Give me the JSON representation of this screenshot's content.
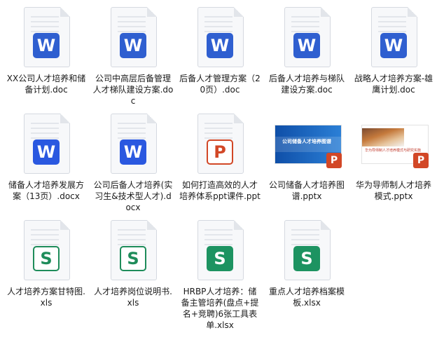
{
  "files": [
    {
      "name": "XX公司人才培养和储备计划.doc",
      "type": "doc",
      "icon": "word-icon",
      "letter": "W"
    },
    {
      "name": "公司中高层后备管理人才梯队建设方案.doc",
      "type": "doc",
      "icon": "word-icon",
      "letter": "W"
    },
    {
      "name": "后备人才管理方案（20页）.doc",
      "type": "doc",
      "icon": "word-icon",
      "letter": "W"
    },
    {
      "name": "后备人才培养与梯队建设方案.doc",
      "type": "doc",
      "icon": "word-icon",
      "letter": "W"
    },
    {
      "name": "战略人才培养方案-雄鹰计划.doc",
      "type": "doc",
      "icon": "word-icon",
      "letter": "W"
    },
    {
      "name": "储备人才培养发展方案（13页）.docx",
      "type": "docx",
      "icon": "word-icon",
      "letter": "W"
    },
    {
      "name": "公司后备人才培养(实习生&技术型人才).docx",
      "type": "docx",
      "icon": "word-icon",
      "letter": "W"
    },
    {
      "name": "如何打造高效的人才培养体系ppt课件.ppt",
      "type": "ppt",
      "icon": "powerpoint-icon",
      "letter": "P"
    },
    {
      "name": "公司储备人才培养图谱.pptx",
      "type": "pptx-blue",
      "icon": "powerpoint-icon",
      "letter": "P",
      "thumb_text": "公司储备人才培养图谱"
    },
    {
      "name": "华为导师制人才培养模式.pptx",
      "type": "pptx-photo",
      "icon": "powerpoint-icon",
      "letter": "P",
      "thumb_text": "华为导师制人才培养模式与研究实施"
    },
    {
      "name": "人才培养方案甘特图.xls",
      "type": "xls",
      "icon": "excel-icon",
      "letter": "S"
    },
    {
      "name": "人才培养岗位说明书.xls",
      "type": "xls",
      "icon": "excel-icon",
      "letter": "S"
    },
    {
      "name": "HRBP人才培养：储备主管培养(盘点+提名+竞聘)6张工具表单.xlsx",
      "type": "xlsx",
      "icon": "excel-icon",
      "letter": "S"
    },
    {
      "name": "重点人才培养档案模板.xlsx",
      "type": "xlsx",
      "icon": "excel-icon",
      "letter": "S"
    }
  ],
  "colors": {
    "word": "#2f5fd0",
    "powerpoint": "#d24726",
    "excel": "#1e8c5a"
  }
}
